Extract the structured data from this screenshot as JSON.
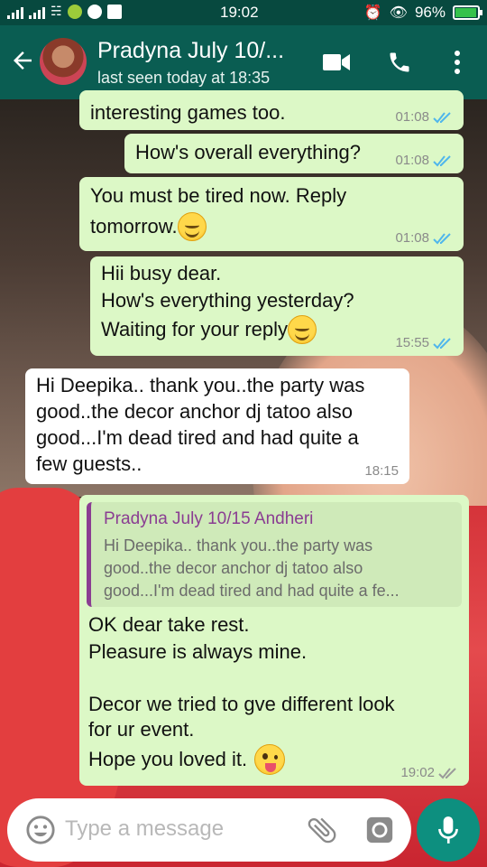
{
  "status_bar": {
    "time": "19:02",
    "battery": "96%",
    "battery_level": 0.96
  },
  "header": {
    "contact_name": "Pradyna July 10/...",
    "last_seen": "last seen today at 18:35"
  },
  "messages": [
    {
      "type": "outgoing",
      "lines": [
        "interesting games too."
      ],
      "time": "01:08"
    },
    {
      "type": "outgoing",
      "lines": [
        "How's overall everything?"
      ],
      "time": "01:08"
    },
    {
      "type": "outgoing",
      "lines": [
        "You must be tired now. Reply",
        "tomorrow."
      ],
      "emoji": "smile",
      "time": "01:08"
    },
    {
      "type": "outgoing",
      "lines": [
        "Hii busy dear.",
        "How's everything yesterday?",
        "Waiting for your reply"
      ],
      "emoji": "smile",
      "time": "15:55"
    },
    {
      "type": "incoming",
      "lines": [
        "Hi Deepika.. thank you..the party was",
        "good..the decor anchor dj tatoo also",
        "good...I'm dead tired and had quite a",
        "few guests.."
      ],
      "time": "18:15"
    },
    {
      "type": "outgoing",
      "quote": {
        "author": "Pradyna July 10/15 Andheri",
        "lines": [
          "Hi Deepika.. thank you..the party was",
          "good..the decor anchor dj tatoo also",
          "good...I'm dead tired and had quite a fe..."
        ]
      },
      "lines": [
        "OK dear take rest.",
        "Pleasure is always mine.",
        "",
        "Decor we tried to gve different look",
        "for ur event.",
        "Hope you loved it."
      ],
      "emoji": "wink",
      "time": "19:02"
    }
  ],
  "input": {
    "placeholder": "Type a message"
  },
  "icons": {
    "back": "arrow-back-icon",
    "video": "video-call-icon",
    "call": "phone-icon",
    "menu": "more-vert-icon",
    "emoji": "emoji-icon",
    "attach": "paperclip-icon",
    "camera": "camera-icon",
    "mic": "mic-icon"
  },
  "colors": {
    "header": "#0a5d52",
    "status_bar": "#07493f",
    "outgoing_bubble": "#dcf8c6",
    "incoming_bubble": "#ffffff",
    "read_ticks": "#4fb6ec",
    "fab": "#0d8f7f",
    "quote_bar": "#8a3d92"
  }
}
